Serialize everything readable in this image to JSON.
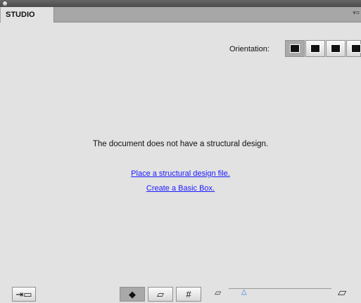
{
  "panel": {
    "tab_label": "STUDIO",
    "menu_icon": "panel-menu-icon"
  },
  "orientation": {
    "label": "Orientation:",
    "buttons": [
      "orientation-front-icon",
      "orientation-side-icon",
      "orientation-top-icon",
      "orientation-back-icon"
    ],
    "active_index": 0
  },
  "content": {
    "message": "The document does not have a structural design.",
    "link_place": "Place a structural design file.",
    "link_create": "Create a Basic Box."
  },
  "bottom": {
    "left_button_icon": "export-import-icon",
    "modes": [
      "solid-view-icon",
      "wireframe-box-icon",
      "grid-icon"
    ],
    "active_mode_index": 0,
    "zoom_small_icon": "zoom-small-icon",
    "zoom_large_icon": "zoom-large-icon",
    "slider_value": 0.15
  },
  "colors": {
    "background": "#e2e2e2",
    "link": "#1b1bff",
    "slider_thumb": "#2478e8"
  }
}
